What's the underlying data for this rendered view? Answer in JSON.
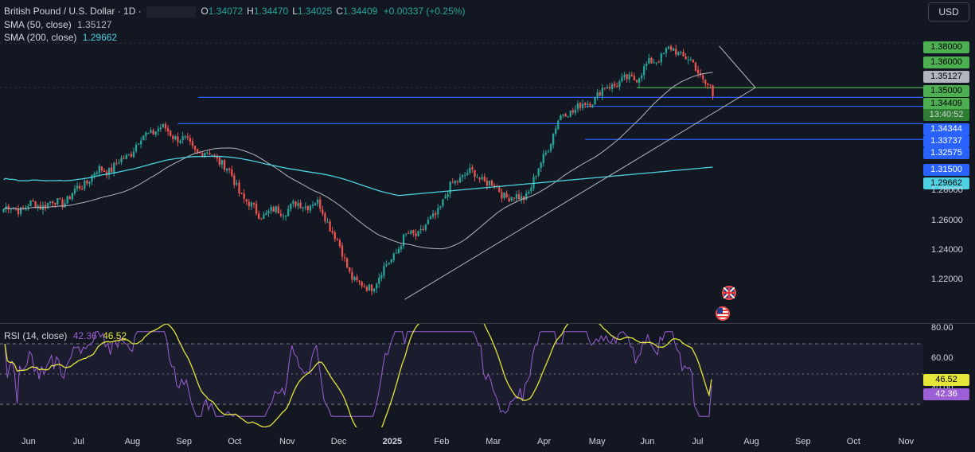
{
  "header": {
    "symbol_title": "British Pound / U.S. Dollar · 1D ·",
    "ohlc": [
      {
        "key": "O",
        "value": "1.34072"
      },
      {
        "key": "H",
        "value": "1.34470"
      },
      {
        "key": "L",
        "value": "1.34025"
      },
      {
        "key": "C",
        "value": "1.34409"
      }
    ],
    "change": "+0.00337 (+0.25%)",
    "sma50_label": "SMA (50, close)",
    "sma50_value": "1.35127",
    "sma200_label": "SMA (200, close)",
    "sma200_value": "1.29662",
    "currency_button": "USD"
  },
  "colors": {
    "background": "#131722",
    "up": "#26a69a",
    "down": "#ef5350",
    "sma50": "#b2b5be",
    "sma200": "#4dd0e1",
    "rsi": "#9c5fd6",
    "rsi_ma": "#e6e63a",
    "level_blue": "#2962ff",
    "level_green": "#4caf50"
  },
  "chart_data": {
    "type": "candlestick",
    "title": "British Pound / U.S. Dollar · 1D",
    "ylim": [
      1.205,
      1.378
    ],
    "x_tick_labels": [
      "Jun",
      "Jul",
      "Aug",
      "Sep",
      "Oct",
      "Nov",
      "Dec",
      "2025",
      "Feb",
      "Mar",
      "Apr",
      "May",
      "Jun",
      "Jul",
      "Aug",
      "Sep",
      "Oct",
      "Nov"
    ],
    "y_tick_labels": [
      "1.38000",
      "1.36000",
      "1.35000",
      "1.28000",
      "1.26000",
      "1.24000",
      "1.22000"
    ],
    "price_labels": [
      {
        "value": "1.38000",
        "kind": "green"
      },
      {
        "value": "1.36000",
        "kind": "green"
      },
      {
        "value": "1.35127",
        "kind": "gray"
      },
      {
        "value": "1.35000",
        "kind": "green"
      },
      {
        "value": "1.34409",
        "kind": "green"
      },
      {
        "value": "13:40:52",
        "kind": "green-dark"
      },
      {
        "value": "1.34344",
        "kind": "blue"
      },
      {
        "value": "1.33737",
        "kind": "blue"
      },
      {
        "value": "1.32575",
        "kind": "blue"
      },
      {
        "value": "1.31500",
        "kind": "blue"
      },
      {
        "value": "1.29662",
        "kind": "cyan"
      }
    ],
    "horizontal_levels": [
      {
        "price": 1.35,
        "color": "green",
        "from": "2025-06"
      },
      {
        "price": 1.3434,
        "color": "blue",
        "from": "2024-09"
      },
      {
        "price": 1.3374,
        "color": "blue",
        "from": "2025-05"
      },
      {
        "price": 1.3257,
        "color": "blue",
        "from": "2024-08"
      },
      {
        "price": 1.315,
        "color": "blue",
        "from": "2025-05"
      }
    ],
    "series": [
      {
        "name": "SMA (50, close)",
        "last": 1.35127
      },
      {
        "name": "SMA (200, close)",
        "last": 1.29662
      }
    ],
    "anchors": [
      {
        "month": "Jun 2024",
        "price": 1.268
      },
      {
        "month": "Jul 2024",
        "price": 1.272
      },
      {
        "month": "Aug 2024",
        "price": 1.295
      },
      {
        "month": "Sep 2024",
        "price": 1.322
      },
      {
        "month": "Oct 2024",
        "price": 1.305
      },
      {
        "month": "Nov 2024",
        "price": 1.265
      },
      {
        "month": "Dec 2024",
        "price": 1.272
      },
      {
        "month": "Jan 2025",
        "price": 1.215
      },
      {
        "month": "Feb 2025",
        "price": 1.252
      },
      {
        "month": "Mar 2025",
        "price": 1.292
      },
      {
        "month": "Apr 2025",
        "price": 1.275
      },
      {
        "month": "May 2025",
        "price": 1.335
      },
      {
        "month": "Jun 2025",
        "price": 1.354
      },
      {
        "month": "Jul 2025",
        "price": 1.375
      },
      {
        "month": "Jul 2025 end",
        "price": 1.344
      }
    ],
    "last": 1.34409
  },
  "rsi": {
    "label": "RSI (14, close)",
    "value": "42.36",
    "ma_value": "46.52",
    "ylim": [
      20,
      80
    ],
    "y_tick_labels": [
      "80.00",
      "60.00",
      "40.00"
    ],
    "bands": {
      "upper": 70,
      "lower": 30
    }
  }
}
